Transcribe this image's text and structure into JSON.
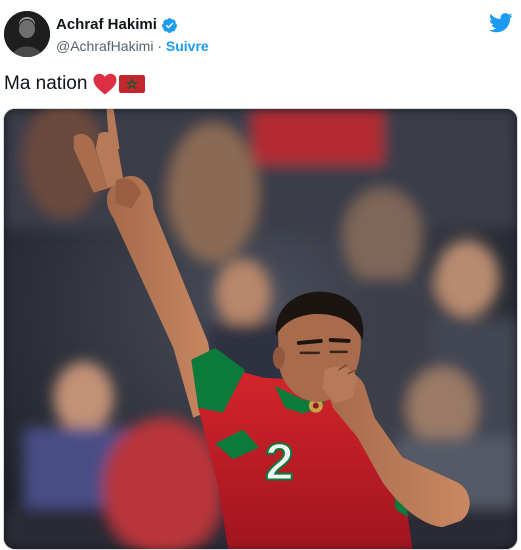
{
  "author": {
    "name": "Achraf Hakimi",
    "handle": "@AchrafHakimi",
    "separator": "·",
    "follow_label": "Suivre",
    "verified": true,
    "avatar_icon": "avatar-photo"
  },
  "tweet": {
    "text": "Ma nation",
    "emojis": [
      "red-heart-icon",
      "morocco-flag-icon"
    ]
  },
  "media": {
    "kind": "photo",
    "jersey_number": "2"
  },
  "brand": {
    "icon": "twitter-bird-icon",
    "color": "#1d9bf0"
  },
  "colors": {
    "link_blue": "#1d9bf0",
    "text_primary": "#0f1419",
    "text_secondary": "#536471",
    "jersey_red": "#c8102e",
    "jersey_green": "#006233"
  }
}
